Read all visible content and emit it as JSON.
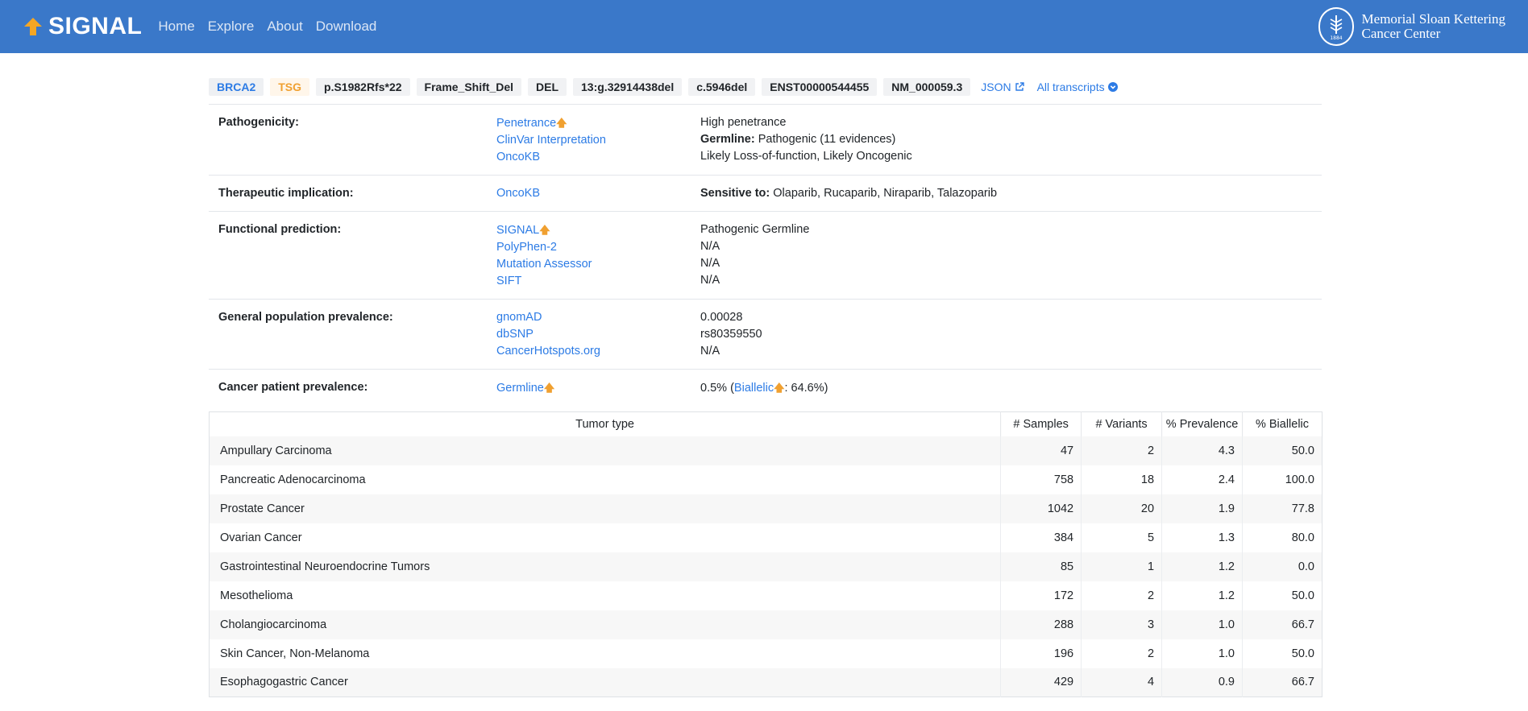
{
  "header": {
    "brand": "SIGNAL",
    "nav": [
      "Home",
      "Explore",
      "About",
      "Download"
    ],
    "institution_line1": "Memorial Sloan Kettering",
    "institution_line2": "Cancer Center",
    "institution_seal_text": "1884"
  },
  "colors": {
    "navbar": "#3a78c9",
    "link": "#2c7be5",
    "accent": "#f0a030"
  },
  "badges": {
    "gene": "BRCA2",
    "role": "TSG",
    "protein_change": "p.S1982Rfs*22",
    "consequence": "Frame_Shift_Del",
    "variant_type": "DEL",
    "genomic": "13:g.32914438del",
    "hgvsc": "c.5946del",
    "transcript": "ENST00000544455",
    "refseq": "NM_000059.3",
    "json_link": "JSON",
    "json_icon": "external-link-icon",
    "transcripts_link": "All transcripts",
    "transcripts_icon": "chevron-circle-down-icon"
  },
  "annotations": [
    {
      "label": "Pathogenicity:",
      "sources": [
        "Penetrance",
        "ClinVar Interpretation",
        "OncoKB"
      ],
      "values": [
        "High penetrance",
        "Pathogenic (11 evidences)",
        "Likely Loss-of-function, Likely Oncogenic"
      ],
      "value_prefix": "Germline:"
    },
    {
      "label": "Therapeutic implication:",
      "sources": [
        "OncoKB"
      ],
      "value_prefix": "Sensitive to:",
      "values": [
        "Olaparib, Rucaparib, Niraparib, Talazoparib"
      ]
    },
    {
      "label": "Functional prediction:",
      "sources": [
        "SIGNAL",
        "PolyPhen-2",
        "Mutation Assessor",
        "SIFT"
      ],
      "values": [
        "Pathogenic Germline",
        "N/A",
        "N/A",
        "N/A"
      ]
    },
    {
      "label": "General population prevalence:",
      "sources": [
        "gnomAD",
        "dbSNP",
        "CancerHotspots.org"
      ],
      "values": [
        "0.00028",
        "rs80359550",
        "N/A"
      ]
    },
    {
      "label": "Cancer patient prevalence:",
      "sources": [
        "Germline"
      ],
      "value_pre": "0.5% (",
      "value_link": "Biallelic",
      "value_post": ": 64.6%)"
    }
  ],
  "table": {
    "columns": [
      "Tumor type",
      "# Samples",
      "# Variants",
      "% Prevalence",
      "% Biallelic"
    ],
    "sorted_column": "% Prevalence",
    "rows": [
      [
        "Ampullary Carcinoma",
        "47",
        "2",
        "4.3",
        "50.0"
      ],
      [
        "Pancreatic Adenocarcinoma",
        "758",
        "18",
        "2.4",
        "100.0"
      ],
      [
        "Prostate Cancer",
        "1042",
        "20",
        "1.9",
        "77.8"
      ],
      [
        "Ovarian Cancer",
        "384",
        "5",
        "1.3",
        "80.0"
      ],
      [
        "Gastrointestinal Neuroendocrine Tumors",
        "85",
        "1",
        "1.2",
        "0.0"
      ],
      [
        "Mesothelioma",
        "172",
        "2",
        "1.2",
        "50.0"
      ],
      [
        "Cholangiocarcinoma",
        "288",
        "3",
        "1.0",
        "66.7"
      ],
      [
        "Skin Cancer, Non-Melanoma",
        "196",
        "2",
        "1.0",
        "50.0"
      ],
      [
        "Esophagogastric Cancer",
        "429",
        "4",
        "0.9",
        "66.7"
      ]
    ]
  }
}
